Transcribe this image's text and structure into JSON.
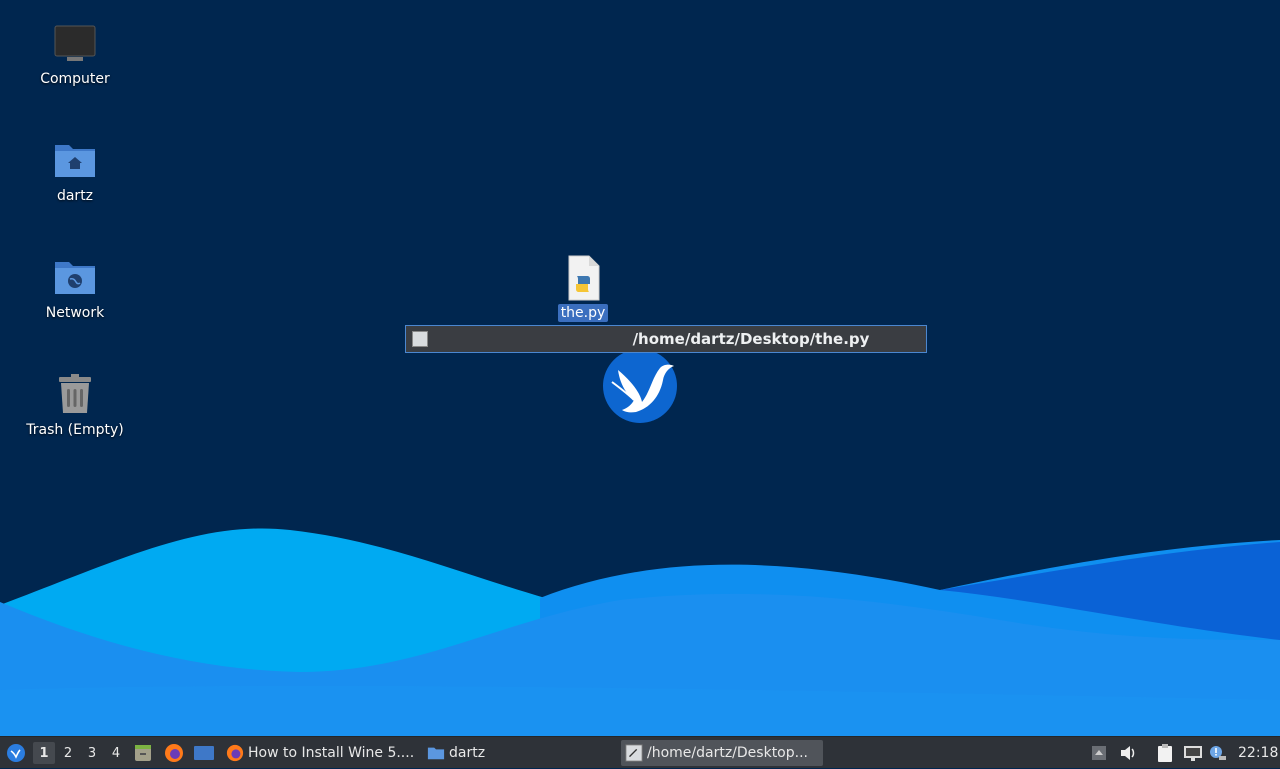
{
  "desktop": {
    "icons": [
      {
        "label": "Computer"
      },
      {
        "label": "dartz"
      },
      {
        "label": "Network"
      },
      {
        "label": "Trash (Empty)"
      },
      {
        "label": "the.py"
      }
    ],
    "rename_bar": {
      "path": "/home/dartz/Desktop/the.py"
    }
  },
  "taskbar": {
    "workspaces": [
      "1",
      "2",
      "3",
      "4"
    ],
    "active_workspace": "1",
    "tasks": [
      {
        "label": "How to Install Wine 5....",
        "icon": "firefox-icon"
      },
      {
        "label": "dartz",
        "icon": "folder-icon"
      },
      {
        "label": "/home/dartz/Desktop...",
        "icon": "terminal-icon"
      }
    ],
    "clock": "22:18"
  },
  "colors": {
    "background": "#00264f",
    "wave_light": "#00a8f0",
    "wave_mid": "#1690ee",
    "wave_dark": "#0b64d8",
    "selection": "#3b6fbf",
    "taskbar": "#2e3238"
  }
}
